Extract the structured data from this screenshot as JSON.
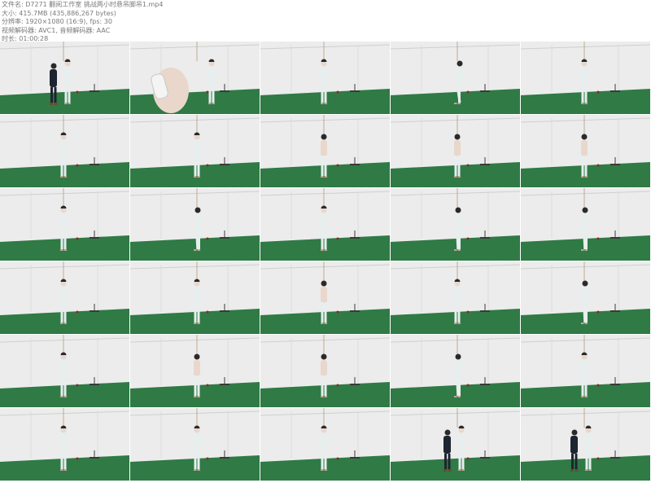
{
  "header": {
    "lines": [
      "文件名: D7271 翻阅工作室 挑战两小时悬吊脚吊1.mp4",
      "大小: 415.7MB (435,886,267 bytes)",
      "分辨率: 1920×1080 (16:9), fps: 30",
      "视频解码器: AVC1, 音频解码器: AAC",
      "时长: 01:00:28"
    ]
  },
  "thumbnails": [
    {
      "id": 1,
      "pose": "two-people"
    },
    {
      "id": 2,
      "pose": "hand-closeup"
    },
    {
      "id": 3,
      "pose": "front"
    },
    {
      "id": 4,
      "pose": "lean"
    },
    {
      "id": 5,
      "pose": "front"
    },
    {
      "id": 6,
      "pose": "front"
    },
    {
      "id": 7,
      "pose": "front"
    },
    {
      "id": 8,
      "pose": "back"
    },
    {
      "id": 9,
      "pose": "back"
    },
    {
      "id": 10,
      "pose": "back"
    },
    {
      "id": 11,
      "pose": "front"
    },
    {
      "id": 12,
      "pose": "side"
    },
    {
      "id": 13,
      "pose": "front"
    },
    {
      "id": 14,
      "pose": "side"
    },
    {
      "id": 15,
      "pose": "side"
    },
    {
      "id": 16,
      "pose": "front"
    },
    {
      "id": 17,
      "pose": "front"
    },
    {
      "id": 18,
      "pose": "back"
    },
    {
      "id": 19,
      "pose": "front"
    },
    {
      "id": 20,
      "pose": "side"
    },
    {
      "id": 21,
      "pose": "front"
    },
    {
      "id": 22,
      "pose": "back"
    },
    {
      "id": 23,
      "pose": "back"
    },
    {
      "id": 24,
      "pose": "side"
    },
    {
      "id": 25,
      "pose": "front"
    },
    {
      "id": 26,
      "pose": "front"
    },
    {
      "id": 27,
      "pose": "front"
    },
    {
      "id": 28,
      "pose": "front"
    },
    {
      "id": 29,
      "pose": "two-people"
    },
    {
      "id": 30,
      "pose": "two-people"
    }
  ],
  "colors": {
    "wall": "#ececec",
    "floor": "#2f7a45",
    "ceiling_line": "#cfcfcf",
    "outfit": "#e7eeee",
    "skin": "#e9d7cc",
    "hair": "#2a2a2a",
    "helper": "#1d2530"
  }
}
